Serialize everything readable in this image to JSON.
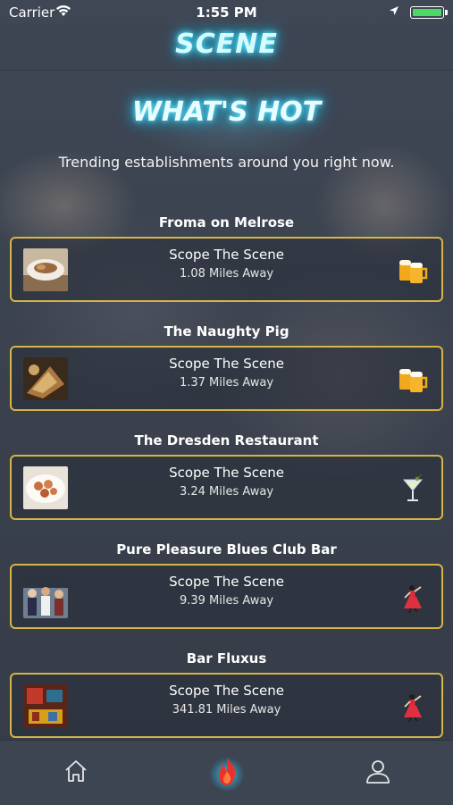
{
  "status_bar": {
    "carrier": "Carrier",
    "time": "1:55 PM",
    "battery_color": "#4cd964"
  },
  "nav": {
    "title": "SCENE",
    "accent_color": "#27c7f0"
  },
  "hero": {
    "title": "WHAT'S HOT",
    "subtitle": "Trending establishments around you right now."
  },
  "venues": [
    {
      "name": "Froma on Melrose",
      "action": "Scope The Scene",
      "distance": "1.08 Miles Away",
      "thumb": "food-plate-thumbnail",
      "icon": "beer-mugs-icon"
    },
    {
      "name": "The Naughty Pig",
      "action": "Scope The Scene",
      "distance": "1.37 Miles Away",
      "thumb": "food-board-thumbnail",
      "icon": "beer-mugs-icon"
    },
    {
      "name": "The Dresden Restaurant",
      "action": "Scope The Scene",
      "distance": "3.24 Miles Away",
      "thumb": "food-dish-thumbnail",
      "icon": "martini-glass-icon"
    },
    {
      "name": "Pure Pleasure Blues Club Bar",
      "action": "Scope The Scene",
      "distance": "9.39 Miles Away",
      "thumb": "club-crowd-thumbnail",
      "icon": "dancer-icon"
    },
    {
      "name": "Bar Fluxus",
      "action": "Scope The Scene",
      "distance": "341.81 Miles Away",
      "thumb": "bar-interior-thumbnail",
      "icon": "dancer-icon"
    }
  ],
  "card_border_color": "#d7b447",
  "tab_bar": {
    "tabs": [
      {
        "icon": "home-icon"
      },
      {
        "icon": "flame-icon",
        "active": true
      },
      {
        "icon": "profile-icon"
      }
    ]
  }
}
